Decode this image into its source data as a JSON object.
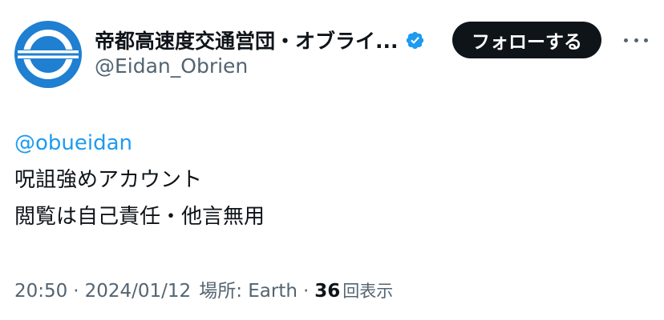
{
  "user": {
    "display_name": "帝都高速度交通営団・オブライ...",
    "handle": "@Eidan_Obrien",
    "verified": true,
    "verified_color": "#1d9bf0",
    "avatar_color": "#1f7fd1"
  },
  "actions": {
    "follow_label": "フォローする",
    "follow_bg": "#0f1419",
    "more_icon": "more-horizontal-icon"
  },
  "tweet": {
    "mention": "@obueidan",
    "lines": [
      "呪詛強めアカウント",
      "閲覧は自己責任・他言無用"
    ],
    "mention_color": "#1d9bf0"
  },
  "meta": {
    "time": "20:50",
    "separator": "·",
    "date": "2024/01/12",
    "location_label": "場所: Earth",
    "views_count": "36",
    "views_label": "回表示"
  }
}
